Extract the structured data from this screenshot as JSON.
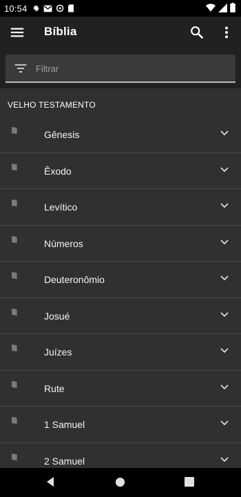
{
  "status_bar": {
    "time": "10:54",
    "icons": [
      "gear-icon",
      "gmail-icon",
      "settings-icon",
      "sd-card-icon"
    ],
    "right_icons": [
      "wifi-icon",
      "signal-icon",
      "battery-icon"
    ]
  },
  "app_bar": {
    "title": "Bíblia",
    "icons": [
      "menu-icon",
      "search-icon",
      "more-vert-icon"
    ]
  },
  "filter": {
    "placeholder": "Filtrar",
    "value": "",
    "icon": "filter-list-icon"
  },
  "section": {
    "header": "VELHO TESTAMENTO"
  },
  "books": [
    {
      "label": "Gênesis"
    },
    {
      "label": "Êxodo"
    },
    {
      "label": "Levítico"
    },
    {
      "label": "Números"
    },
    {
      "label": "Deuteronômio"
    },
    {
      "label": "Josué"
    },
    {
      "label": "Juízes"
    },
    {
      "label": "Rute"
    },
    {
      "label": "1 Samuel"
    },
    {
      "label": "2 Samuel"
    }
  ],
  "nav_bar": {
    "icons": [
      "back-icon",
      "home-icon",
      "recents-icon"
    ]
  },
  "colors": {
    "background": "#303030",
    "app_bar": "#212121",
    "text": "#f5f5f5",
    "divider": "#4a4a4a"
  }
}
